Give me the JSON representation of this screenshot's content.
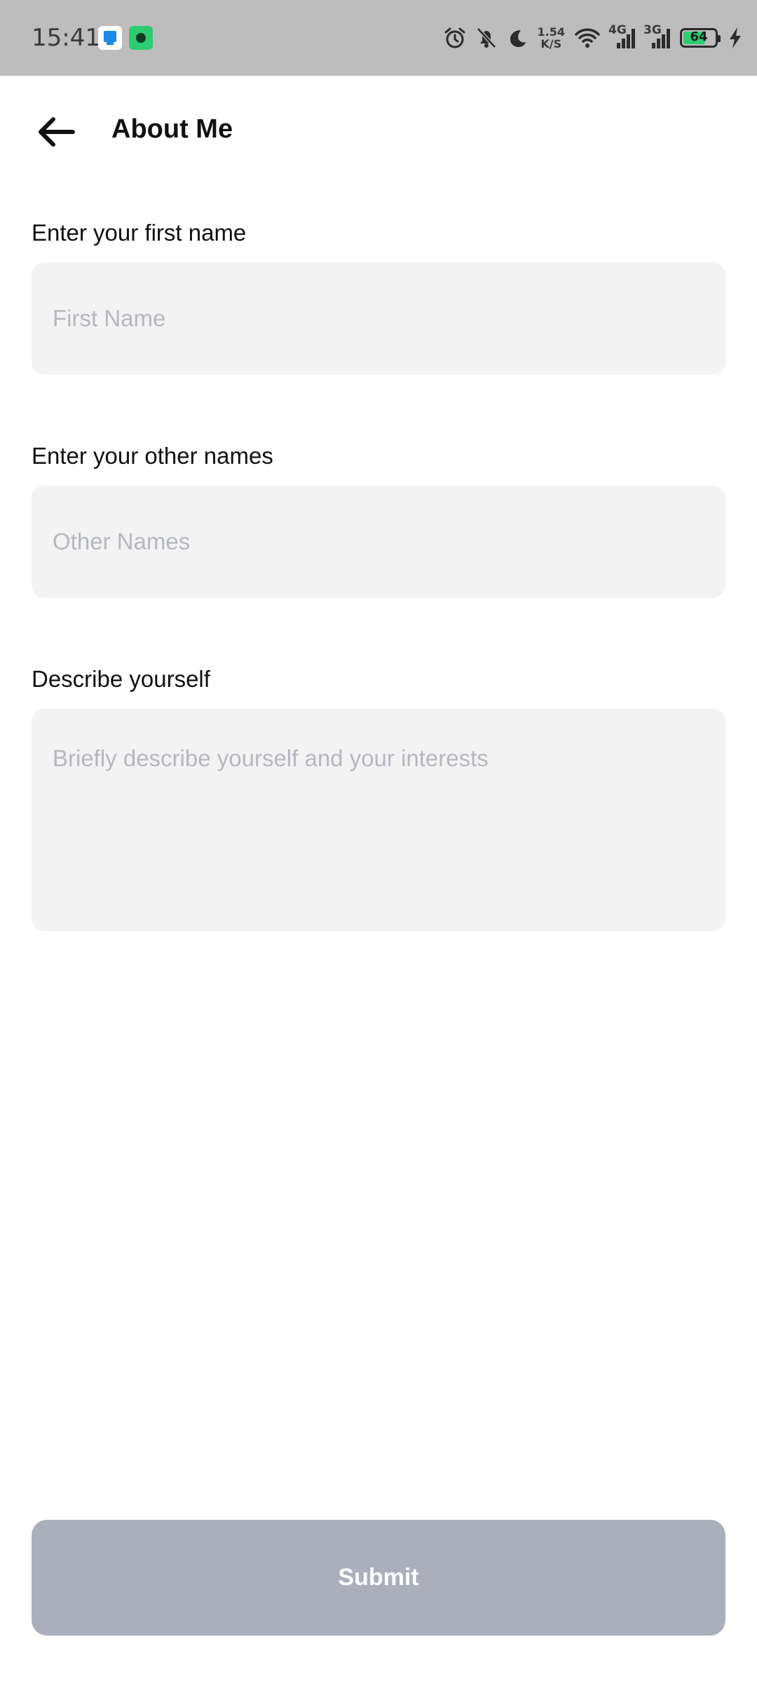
{
  "status_bar": {
    "time": "15:41",
    "net_speed_value": "1.54",
    "net_speed_unit": "K/S",
    "network_1": "4G",
    "network_2": "3G",
    "battery": "64",
    "icons": [
      "alarm-icon",
      "bell-off-icon",
      "moon-icon",
      "wifi-icon",
      "signal-icon",
      "battery-icon",
      "charging-icon"
    ],
    "colors": {
      "background": "#bdbdbd",
      "battery_fill": "#2ecc71"
    }
  },
  "header": {
    "title": "About Me",
    "back_icon": "arrow-left-icon"
  },
  "form": {
    "first_name": {
      "label": "Enter your first name",
      "placeholder": "First Name",
      "value": ""
    },
    "other_names": {
      "label": "Enter your  other names",
      "placeholder": "Other Names",
      "value": ""
    },
    "description": {
      "label": "Describe yourself",
      "placeholder": "Briefly describe yourself and your interests",
      "value": ""
    }
  },
  "submit": {
    "label": "Submit",
    "color": "#abafbb"
  }
}
